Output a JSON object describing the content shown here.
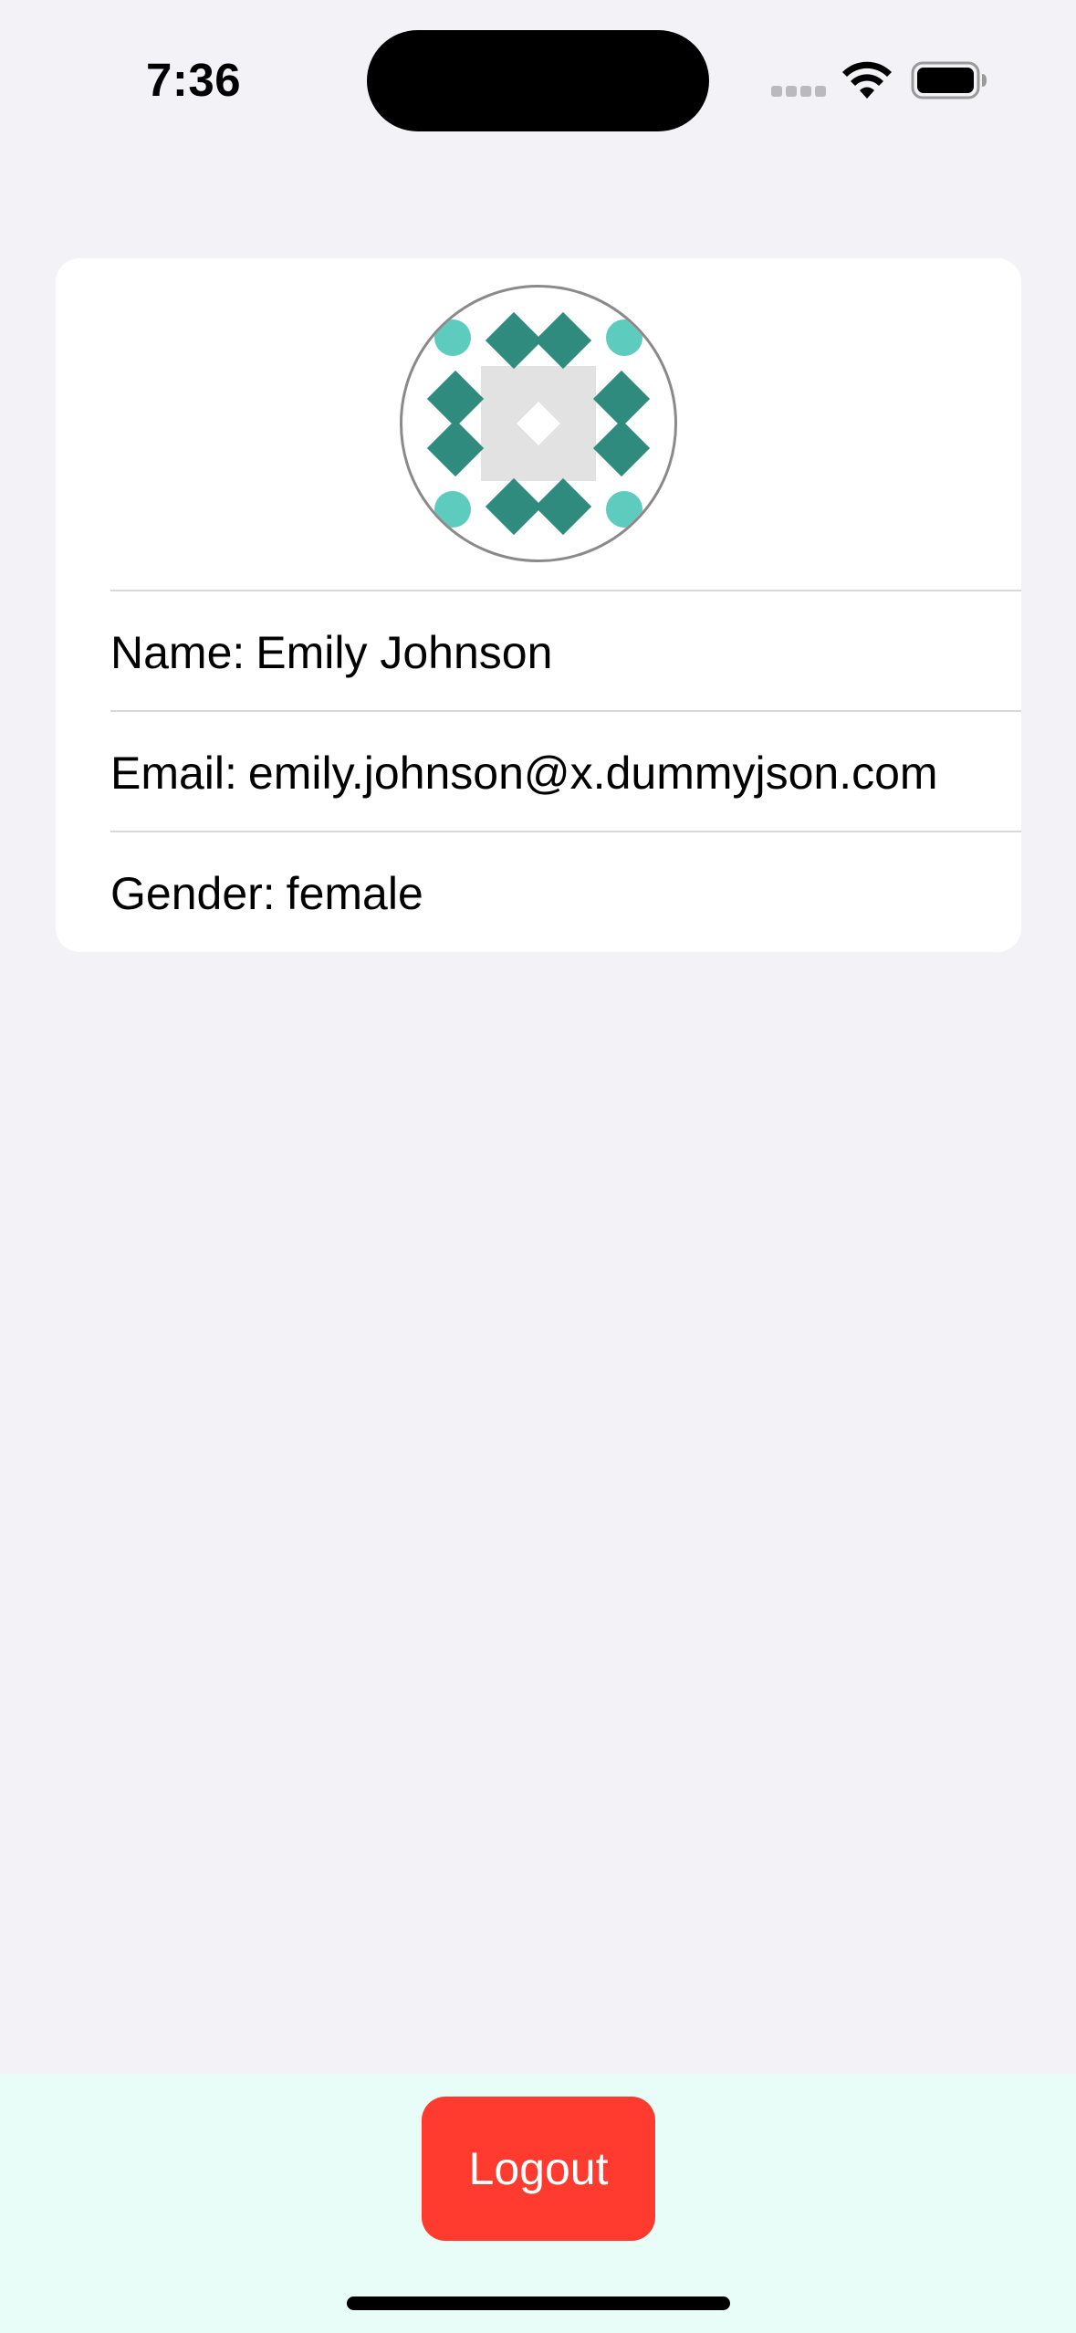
{
  "status_bar": {
    "time": "7:36"
  },
  "profile": {
    "avatar_icon": "identicon-avatar",
    "name_label": "Name:",
    "name_value": "Emily Johnson",
    "email_label": "Email:",
    "email_value": "emily.johnson@x.dummyjson.com",
    "gender_label": "Gender:",
    "gender_value": "female"
  },
  "actions": {
    "logout_label": "Logout"
  },
  "colors": {
    "background": "#f2f2f7",
    "card": "#ffffff",
    "logout": "#ff3b30",
    "bottom_bar": "#e8fdf7",
    "avatar_teal_dark": "#2e8b7e",
    "avatar_teal_light": "#5ecbbf"
  }
}
